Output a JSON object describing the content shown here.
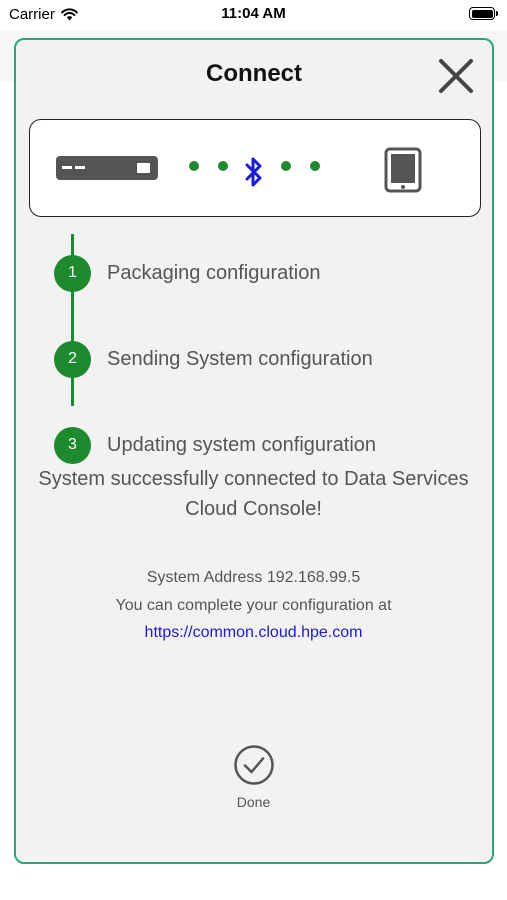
{
  "status_bar": {
    "carrier": "Carrier",
    "time": "11:04 AM"
  },
  "modal": {
    "title": "Connect",
    "steps": [
      {
        "number": "1",
        "label": "Packaging configuration"
      },
      {
        "number": "2",
        "label": "Sending System configuration"
      },
      {
        "number": "3",
        "label": "Updating system configuration"
      }
    ],
    "success_message": "System successfully connected to Data Services Cloud Console!",
    "system_address": "System Address 192.168.99.5",
    "complete_text": "You can complete your configuration at",
    "link": "https://common.cloud.hpe.com",
    "done_label": "Done"
  },
  "colors": {
    "accent_green": "#1d8a2e",
    "border_teal": "#26a87c",
    "bluetooth_blue": "#1a1adb",
    "link_blue": "#1a1adb"
  },
  "icons": [
    "wifi-icon",
    "battery-icon",
    "close-icon",
    "server-icon",
    "bluetooth-icon",
    "tablet-icon",
    "check-circle-icon"
  ]
}
